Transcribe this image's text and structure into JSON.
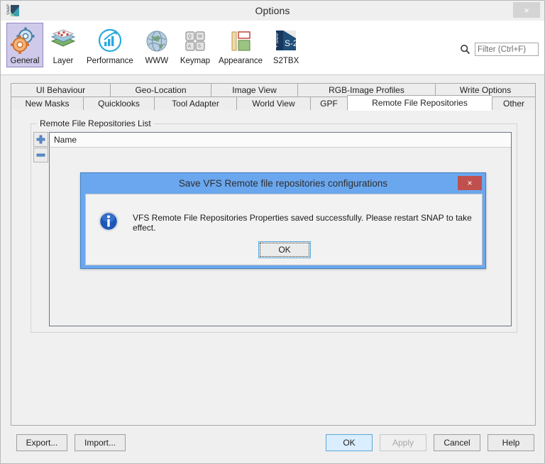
{
  "window": {
    "title": "Options",
    "icon": "snap-logo-icon",
    "close_label": "×"
  },
  "toolbar": {
    "categories": [
      {
        "label": "General",
        "icon": "gears-icon",
        "selected": true
      },
      {
        "label": "Layer",
        "icon": "layers-icon",
        "selected": false
      },
      {
        "label": "Performance",
        "icon": "performance-icon",
        "selected": false
      },
      {
        "label": "WWW",
        "icon": "globe-icon",
        "selected": false
      },
      {
        "label": "Keymap",
        "icon": "keyboard-icon",
        "selected": false
      },
      {
        "label": "Appearance",
        "icon": "appearance-icon",
        "selected": false
      },
      {
        "label": "S2TBX",
        "icon": "s2tbx-icon",
        "selected": false
      }
    ],
    "filter": {
      "placeholder": "Filter (Ctrl+F)",
      "value": "",
      "icon": "search-icon"
    }
  },
  "tabs": {
    "row1": [
      {
        "label": "UI Behaviour",
        "active": false
      },
      {
        "label": "Geo-Location",
        "active": false
      },
      {
        "label": "Image View",
        "active": false
      },
      {
        "label": "RGB-Image Profiles",
        "active": false
      },
      {
        "label": "Write Options",
        "active": false
      }
    ],
    "row2": [
      {
        "label": "New Masks",
        "active": false
      },
      {
        "label": "Quicklooks",
        "active": false
      },
      {
        "label": "Tool Adapter",
        "active": false
      },
      {
        "label": "World View",
        "active": false
      },
      {
        "label": "GPF",
        "active": false
      },
      {
        "label": "Remote File Repositories",
        "active": true
      },
      {
        "label": "Other",
        "active": false
      }
    ]
  },
  "panel": {
    "group_title": "Remote File Repositories List",
    "add_label": "+",
    "remove_label": "−",
    "columns": [
      "Name"
    ],
    "rows": []
  },
  "footer": {
    "export_label": "Export...",
    "import_label": "Import...",
    "ok_label": "OK",
    "apply_label": "Apply",
    "cancel_label": "Cancel",
    "help_label": "Help"
  },
  "dialog": {
    "title": "Save VFS Remote file repositories configurations",
    "close_label": "×",
    "icon": "info-icon",
    "message": "VFS Remote File Repositories Properties saved successfully. Please restart SNAP to take effect.",
    "ok_label": "OK"
  },
  "colors": {
    "dialog_titlebar": "#6aa7ef",
    "dialog_close": "#c0504d",
    "selected_category": "#cfcaea",
    "default_button": "#daeeff",
    "window_bg": "#efefef"
  }
}
